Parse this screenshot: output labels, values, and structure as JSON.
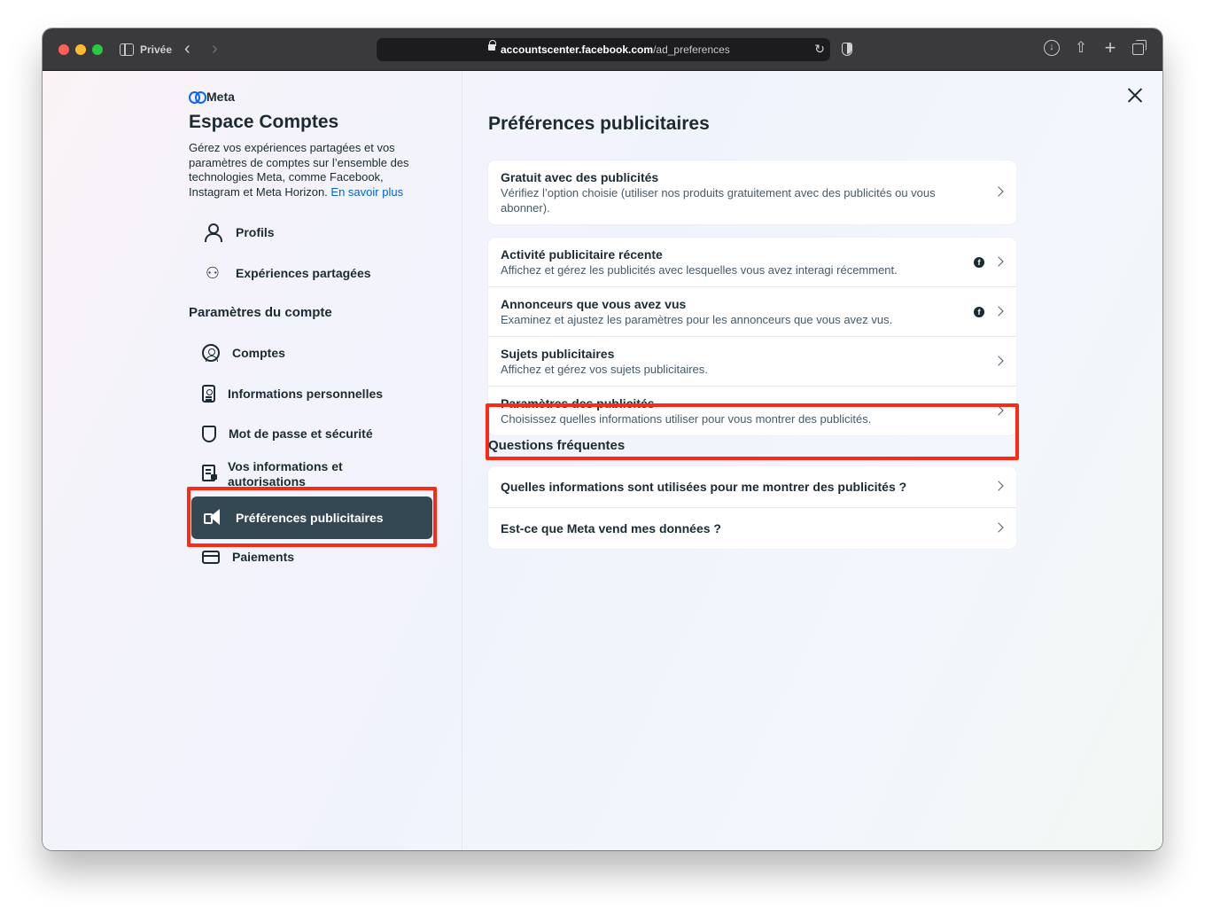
{
  "browser": {
    "private_label": "Privée",
    "url_host": "accountscenter.facebook.com",
    "url_path": "/ad_preferences"
  },
  "sidebar": {
    "brand": "Meta",
    "title": "Espace Comptes",
    "description": "Gérez vos expériences partagées et vos paramètres de comptes sur l’ensemble des technologies Meta, comme Facebook, Instagram et Meta Horizon.",
    "learn_more": "En savoir plus",
    "top_items": [
      {
        "label": "Profils",
        "icon": "person-icon"
      },
      {
        "label": "Expériences partagées",
        "icon": "shared-experiences-icon"
      }
    ],
    "section_title": "Paramètres du compte",
    "account_items": [
      {
        "label": "Comptes",
        "icon": "account-circle-icon"
      },
      {
        "label": "Informations personnelles",
        "icon": "id-badge-icon"
      },
      {
        "label": "Mot de passe et sécurité",
        "icon": "shield-icon"
      },
      {
        "label": "Vos informations et autorisations",
        "icon": "document-lock-icon"
      },
      {
        "label": "Préférences publicitaires",
        "icon": "megaphone-icon",
        "active": true
      },
      {
        "label": "Paiements",
        "icon": "credit-card-icon"
      }
    ]
  },
  "main": {
    "title": "Préférences publicitaires",
    "subscription_card": [
      {
        "title": "Gratuit avec des publicités",
        "desc": "Vérifiez l’option choisie (utiliser nos produits gratuitement avec des publicités ou vous abonner)."
      }
    ],
    "settings_card": [
      {
        "title": "Activité publicitaire récente",
        "desc": "Affichez et gérez les publicités avec lesquelles vous avez interagi récemment.",
        "facebook_badge": true
      },
      {
        "title": "Annonceurs que vous avez vus",
        "desc": "Examinez et ajustez les paramètres pour les annonceurs que vous avez vus.",
        "facebook_badge": true
      },
      {
        "title": "Sujets publicitaires",
        "desc": "Affichez et gérez vos sujets publicitaires."
      },
      {
        "title": "Paramètres des publicités",
        "desc": "Choisissez quelles informations utiliser pour vous montrer des publicités."
      }
    ],
    "faq_title": "Questions fréquentes",
    "faq": [
      {
        "title": "Quelles informations sont utilisées pour me montrer des publicités ?"
      },
      {
        "title": "Est-ce que Meta vend mes données ?"
      }
    ],
    "fb_glyph": "f"
  },
  "colors": {
    "accent_link": "#0064e0",
    "active_nav": "#344854",
    "highlight": "#ff2a15"
  }
}
